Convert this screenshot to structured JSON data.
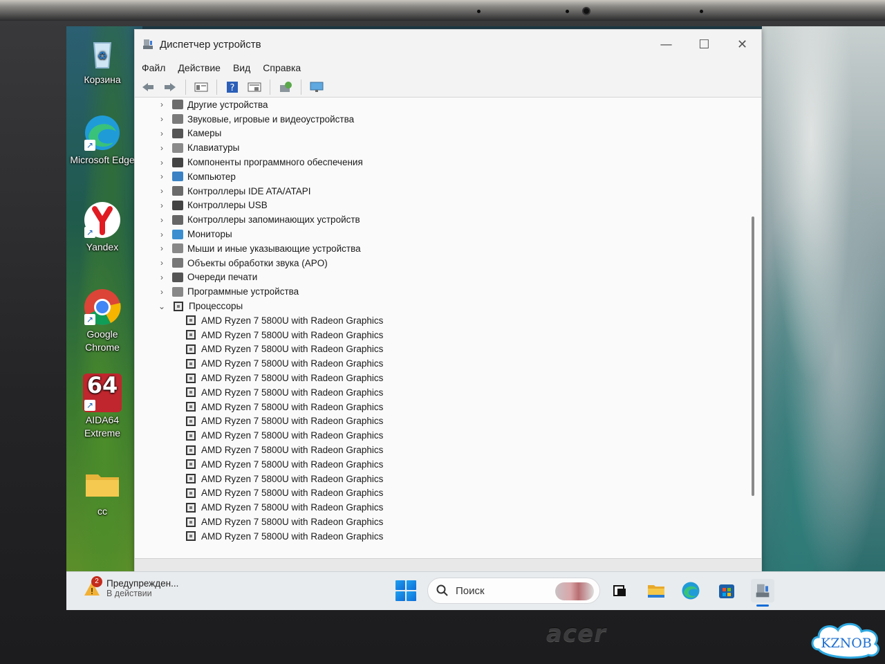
{
  "window": {
    "title": "Диспетчер устройств",
    "menu": [
      "Файл",
      "Действие",
      "Вид",
      "Справка"
    ],
    "controls": {
      "minimize": "—",
      "maximize": "☐",
      "close": "✕"
    }
  },
  "toolbar": {
    "icons": [
      "back-icon",
      "forward-icon",
      "properties-icon",
      "help-icon",
      "details-icon",
      "update-driver-icon",
      "monitor-icon"
    ]
  },
  "tree": {
    "categories": [
      {
        "label": "Другие устройства",
        "state": "collapsed"
      },
      {
        "label": "Звуковые, игровые и видеоустройства",
        "state": "collapsed"
      },
      {
        "label": "Камеры",
        "state": "collapsed"
      },
      {
        "label": "Клавиатуры",
        "state": "collapsed"
      },
      {
        "label": "Компоненты программного обеспечения",
        "state": "collapsed"
      },
      {
        "label": "Компьютер",
        "state": "collapsed"
      },
      {
        "label": "Контроллеры IDE ATA/ATAPI",
        "state": "collapsed"
      },
      {
        "label": "Контроллеры USB",
        "state": "collapsed"
      },
      {
        "label": "Контроллеры запоминающих устройств",
        "state": "collapsed"
      },
      {
        "label": "Мониторы",
        "state": "collapsed"
      },
      {
        "label": "Мыши и иные указывающие устройства",
        "state": "collapsed"
      },
      {
        "label": "Объекты обработки звука (APO)",
        "state": "collapsed"
      },
      {
        "label": "Очереди печати",
        "state": "collapsed"
      },
      {
        "label": "Программные устройства",
        "state": "collapsed"
      },
      {
        "label": "Процессоры",
        "state": "expanded"
      }
    ],
    "processors": [
      "AMD Ryzen 7 5800U with Radeon Graphics",
      "AMD Ryzen 7 5800U with Radeon Graphics",
      "AMD Ryzen 7 5800U with Radeon Graphics",
      "AMD Ryzen 7 5800U with Radeon Graphics",
      "AMD Ryzen 7 5800U with Radeon Graphics",
      "AMD Ryzen 7 5800U with Radeon Graphics",
      "AMD Ryzen 7 5800U with Radeon Graphics",
      "AMD Ryzen 7 5800U with Radeon Graphics",
      "AMD Ryzen 7 5800U with Radeon Graphics",
      "AMD Ryzen 7 5800U with Radeon Graphics",
      "AMD Ryzen 7 5800U with Radeon Graphics",
      "AMD Ryzen 7 5800U with Radeon Graphics",
      "AMD Ryzen 7 5800U with Radeon Graphics",
      "AMD Ryzen 7 5800U with Radeon Graphics",
      "AMD Ryzen 7 5800U with Radeon Graphics",
      "AMD Ryzen 7 5800U with Radeon Graphics"
    ]
  },
  "desktop": {
    "icons": [
      {
        "label": "Корзина",
        "icon": "recycle-bin-icon"
      },
      {
        "label": "Microsoft Edge",
        "icon": "edge-icon"
      },
      {
        "label": "Yandex",
        "icon": "yandex-icon"
      },
      {
        "label": "Google Chrome",
        "icon": "chrome-icon"
      },
      {
        "label": "AIDA64 Extreme",
        "icon": "aida64-icon",
        "glyph_text": "64"
      },
      {
        "label": "cc",
        "icon": "folder-icon"
      }
    ]
  },
  "taskbar": {
    "notification": {
      "count": "2",
      "title": "Предупрежден...",
      "subtitle": "В действии"
    },
    "search_placeholder": "Поиск",
    "apps": [
      "task-view-icon",
      "file-explorer-icon",
      "edge-icon",
      "store-icon",
      "device-manager-icon"
    ]
  },
  "hardware": {
    "brand": "acer",
    "watermark": "KZNOB"
  },
  "colors": {
    "accent": "#0f6cd6",
    "window_bg": "#f3f3f3",
    "tree_bg": "#fafafa"
  }
}
